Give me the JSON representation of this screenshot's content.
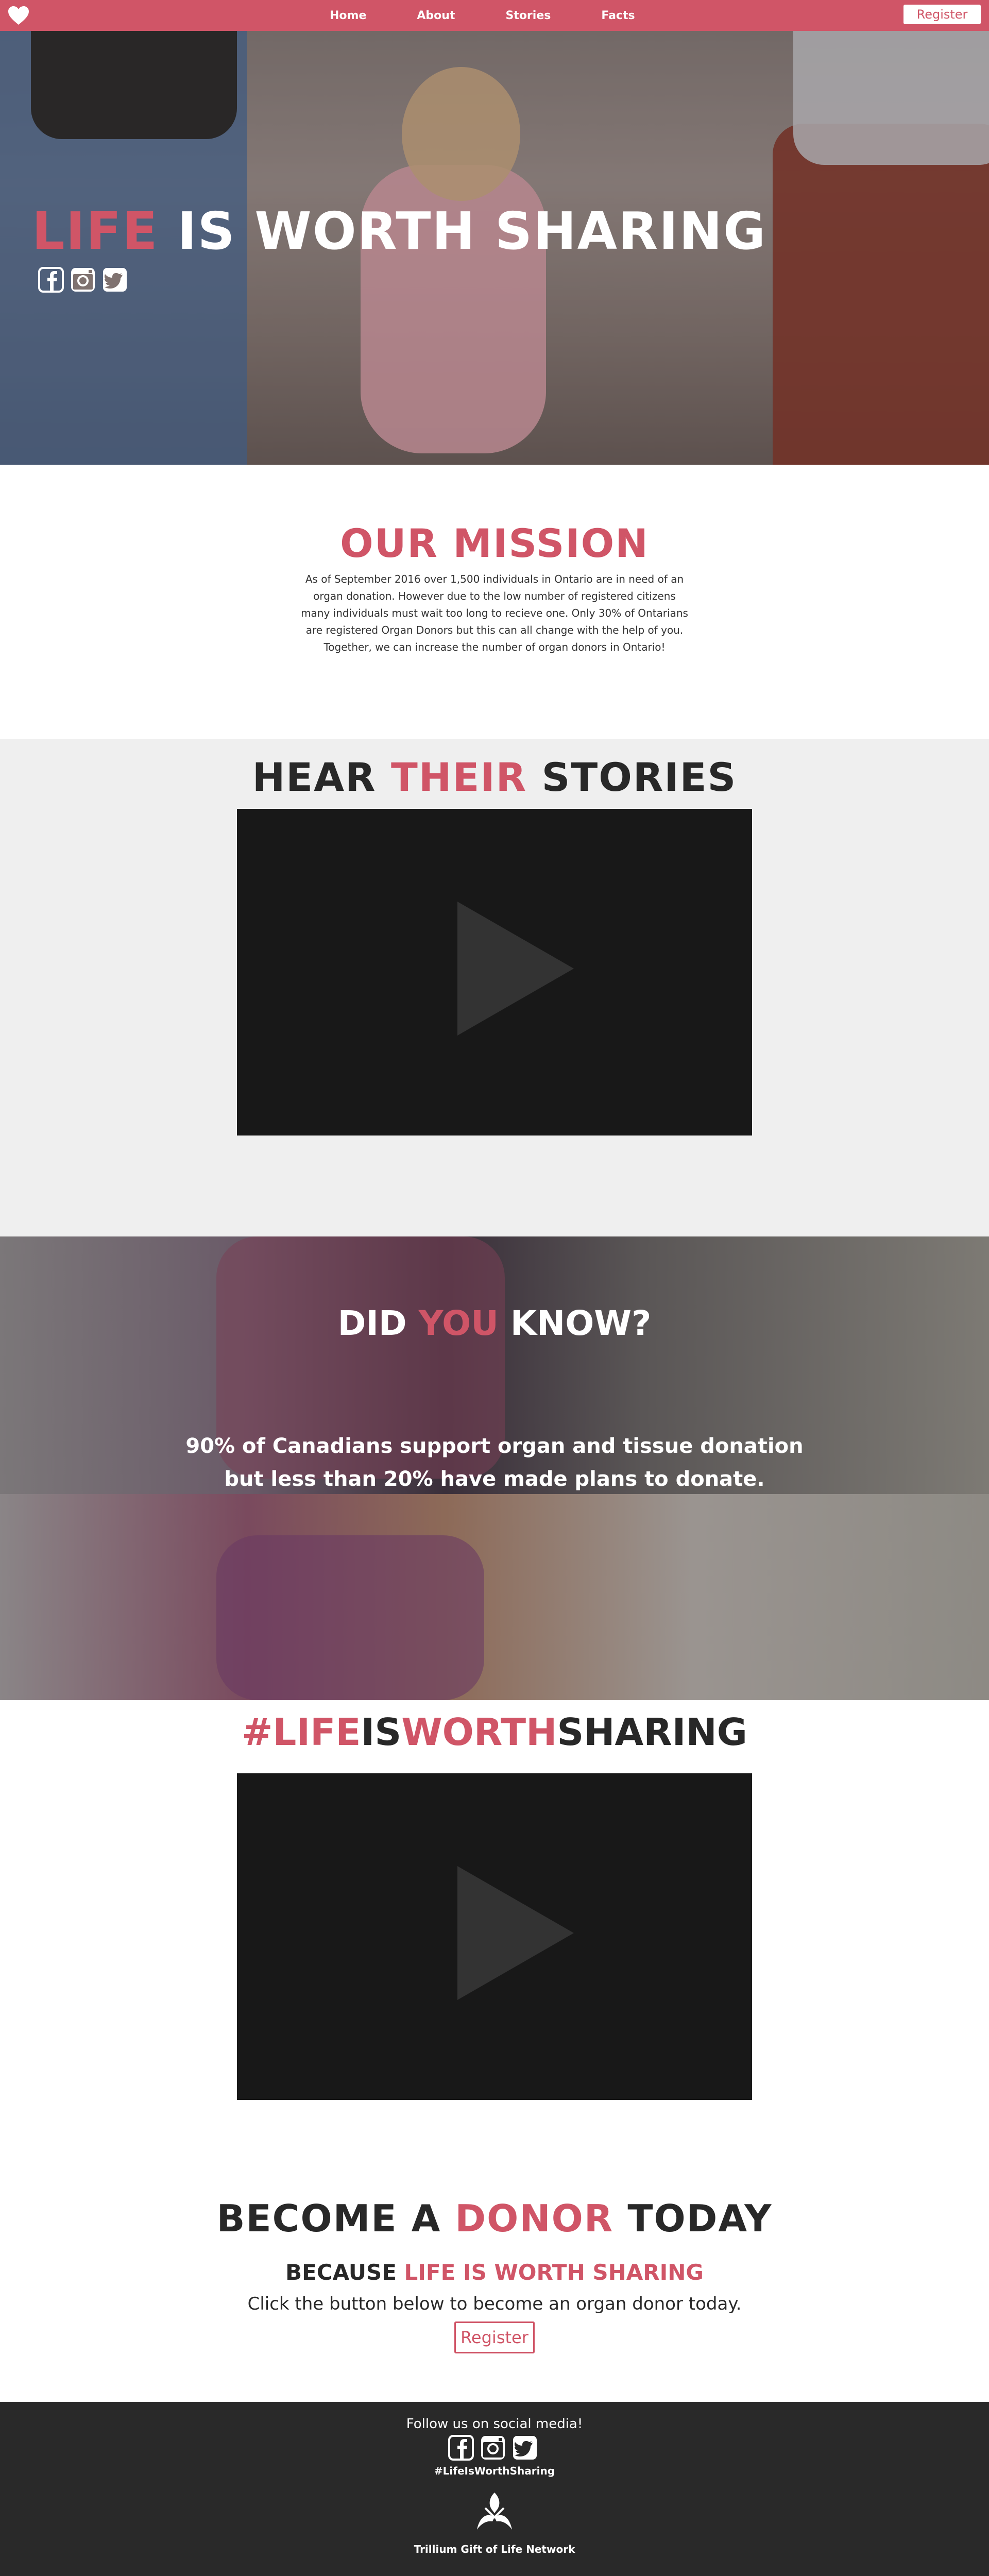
{
  "colors": {
    "accent": "#d05567",
    "dark": "#282828",
    "footer_bg": "#292929",
    "stories_bg": "#efefef"
  },
  "nav": {
    "logo_icon": "heart-icon",
    "links": [
      "Home",
      "About",
      "Stories",
      "Facts"
    ],
    "register_label": "Register"
  },
  "hero": {
    "title_accent": "LIFE",
    "title_rest": " IS WORTH SHARING",
    "social_icons": [
      "facebook-icon",
      "instagram-icon",
      "twitter-icon"
    ]
  },
  "mission": {
    "title": "OUR MISSION",
    "text": "As of September 2016 over 1,500 individuals in Ontario are in need of an organ donation. However due to the low number of registered citizens many individuals must wait too long to recieve one. Only 30% of Ontarians are registered Organ Donors but this can all change with the help of you. Together, we can increase the number of organ donors in Ontario!"
  },
  "stories": {
    "title_a": "HEAR ",
    "title_accent": "THEIR",
    "title_b": " STORIES",
    "video_icon": "play-icon"
  },
  "know": {
    "title_a": "DID ",
    "title_accent": "YOU",
    "title_b": " KNOW?",
    "fact": "90% of Canadians support organ and tissue donation but less than 20% have made plans to donate."
  },
  "hashtag": {
    "part1": "#LIFE",
    "part2": "IS",
    "part3": "WORTH",
    "part4": "SHARING",
    "video_icon": "play-icon"
  },
  "become": {
    "title_a": "BECOME A ",
    "title_accent": "DONOR",
    "title_b": " TODAY",
    "sub_a": "BECAUSE ",
    "sub_accent": "LIFE IS WORTH SHARING",
    "text": "Click the button below to become an organ donor today.",
    "register_label": "Register"
  },
  "footer": {
    "follow": "Follow us on social media!",
    "social_icons": [
      "facebook-icon",
      "instagram-icon",
      "twitter-icon"
    ],
    "hashtag": "#LifeIsWorthSharing",
    "org_logo": "trillium-icon",
    "org_name": "Trillium Gift of Life Network"
  }
}
